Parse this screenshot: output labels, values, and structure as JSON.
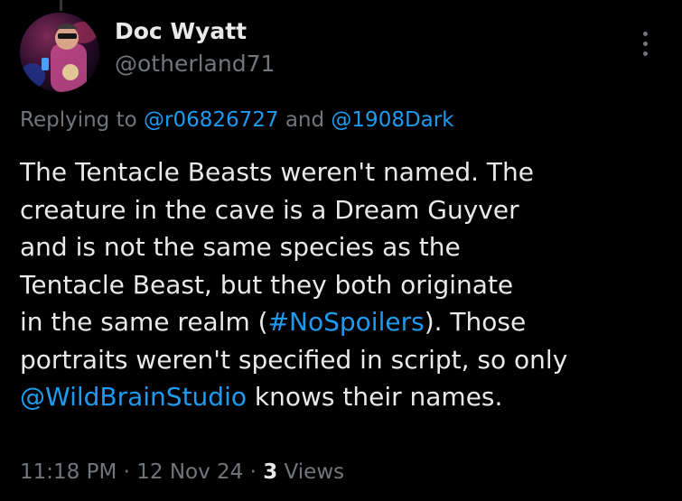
{
  "author": {
    "display_name": "Doc Wyatt",
    "handle": "@otherland71"
  },
  "reply": {
    "prefix": "Replying to ",
    "users": [
      "@r06826727",
      "@1908Dark"
    ],
    "joiner": " and "
  },
  "tweet": {
    "lines": [
      [
        {
          "t": "The Tentacle Beasts weren't named. The"
        }
      ],
      [
        {
          "t": "creature in the cave is a Dream Guyver"
        }
      ],
      [
        {
          "t": "and is not the same species as the"
        }
      ],
      [
        {
          "t": "Tentacle Beast, but they both originate"
        }
      ],
      [
        {
          "t": "in the same realm ("
        },
        {
          "t": "#NoSpoilers",
          "link": true
        },
        {
          "t": "). Those"
        }
      ],
      [
        {
          "t": "portraits weren't specified in script, so only"
        }
      ],
      [
        {
          "t": "@WildBrainStudio",
          "link": true
        },
        {
          "t": " knows their names."
        }
      ]
    ]
  },
  "meta": {
    "time": "11:18 PM",
    "separator": " · ",
    "date": "12 Nov 24",
    "views_count": "3",
    "views_label": " Views"
  },
  "icons": {
    "more": "more-vertical-icon",
    "avatar": "avatar-photo"
  },
  "colors": {
    "background": "#000000",
    "text": "#e7e9ea",
    "secondary": "#71767b",
    "link": "#1d9bf0"
  }
}
